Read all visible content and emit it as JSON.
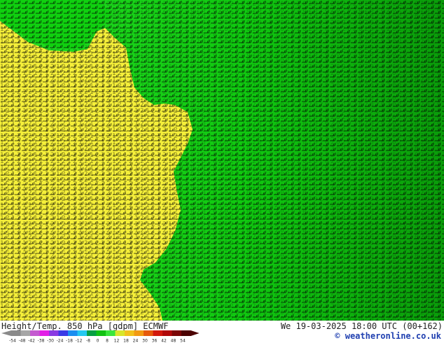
{
  "map": {
    "lowland_fill": "#f5ef3a",
    "lowland_fill_alt": "#e4dd2c",
    "highland_fill": "#10d010",
    "highland_fill_dark": "#0a9c0a",
    "highland_fill_bright": "#22dd22",
    "wind_barb_color": "#000000",
    "grid_digits_yellow": [
      "0",
      "1",
      "2",
      "3"
    ],
    "grid_digits_green": [
      "0",
      "2",
      "5",
      "8"
    ],
    "wind_barbs": "dense"
  },
  "footer": {
    "left_label": "Height/Temp. 850 hPa [gdpm] ECMWF",
    "right_label": "We 19-03-2025 18:00 UTC (00+162)",
    "credit": "© weatheronline.co.uk"
  },
  "scale": {
    "ticks": [
      "-54",
      "-48",
      "-42",
      "-38",
      "-30",
      "-24",
      "-18",
      "-12",
      "-8",
      "0",
      "8",
      "12",
      "18",
      "24",
      "30",
      "36",
      "42",
      "48",
      "54"
    ],
    "colors": [
      "#8a8a8a",
      "#a6a6a6",
      "#c45ad0",
      "#e21fe6",
      "#8a3ae2",
      "#3a3ae6",
      "#1b8ef0",
      "#25c8f0",
      "#07a043",
      "#12c212",
      "#3ae63a",
      "#d8e62a",
      "#f2c21c",
      "#f29a12",
      "#e65a0c",
      "#d2180c",
      "#b00808",
      "#7a0606",
      "#4c0303"
    ]
  }
}
